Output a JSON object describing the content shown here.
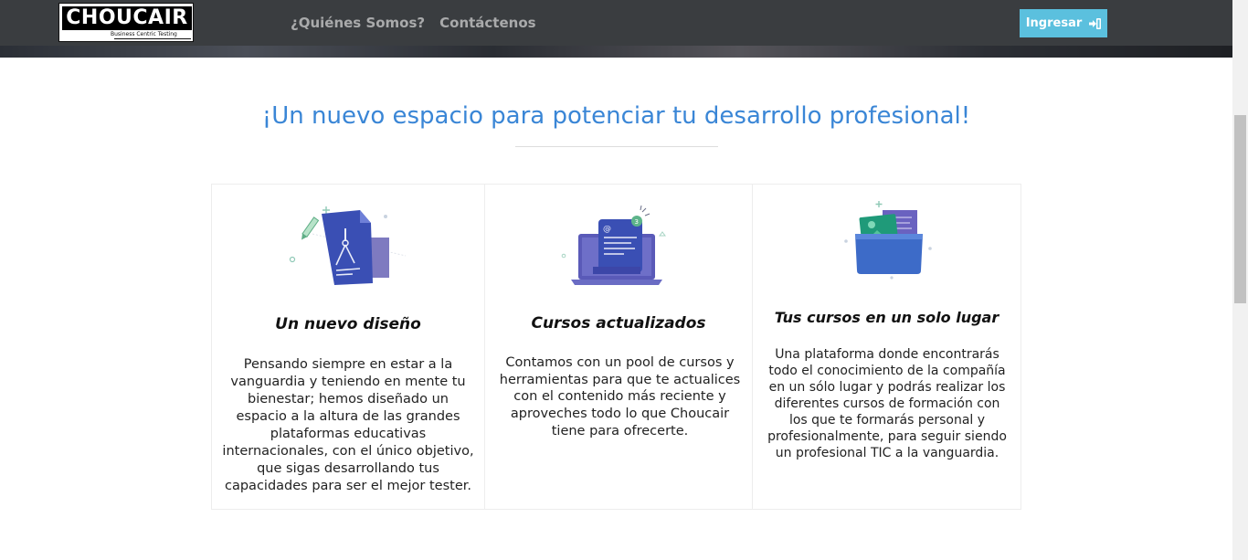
{
  "header": {
    "logo_text": "CHOUCAIR",
    "logo_tagline": "Business Centric Testing",
    "nav": [
      {
        "label": "¿Quiénes Somos?"
      },
      {
        "label": "Contáctenos"
      }
    ],
    "login_label": "Ingresar"
  },
  "main": {
    "headline": "¡Un nuevo espacio para potenciar tu desarrollo profesional!",
    "features": [
      {
        "icon": "design-blueprint-icon",
        "title": "Un nuevo diseño",
        "text": "Pensando siempre en estar a la vanguardia y teniendo en mente tu bienestar; hemos diseñado un espacio a la altura de las grandes plataformas educativas internacionales, con el único objetivo, que sigas desarrollando tus capacidades para ser el mejor tester."
      },
      {
        "icon": "laptop-courses-icon",
        "title": "Cursos actualizados",
        "text": "Contamos con un pool de cursos y herramientas para que te actualices con el contenido más reciente y aproveches todo lo que Choucair tiene para ofrecerte."
      },
      {
        "icon": "folder-icon",
        "title": "Tus cursos en un solo lugar",
        "text": "Una plataforma donde encontrarás todo el conocimiento de la compañía en un sólo lugar y podrás realizar los diferentes cursos de formación con los que te formarás personal y profesionalmente, para seguir siendo un profesional TIC a la vanguardia."
      }
    ]
  },
  "colors": {
    "navbar": "#3a3d40",
    "accent": "#3a86d6",
    "button": "#5bc0de"
  }
}
